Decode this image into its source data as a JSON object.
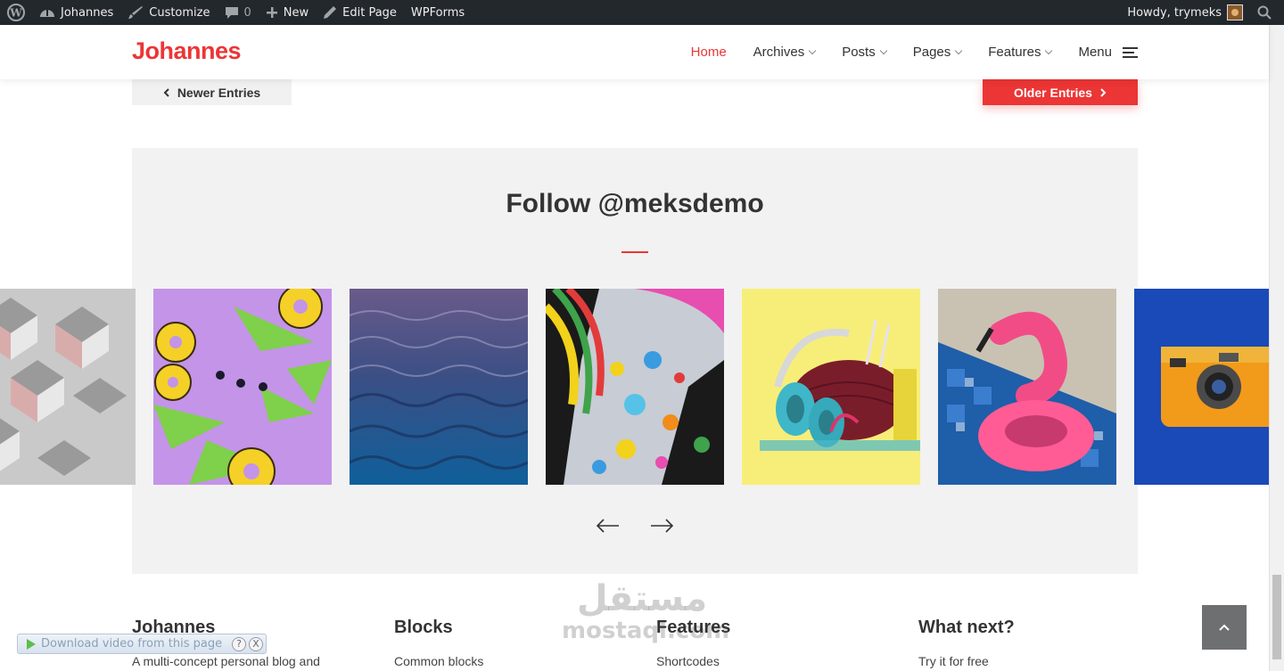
{
  "adminbar": {
    "site_name": "Johannes",
    "customize": "Customize",
    "comments_count": "0",
    "new": "New",
    "edit_page": "Edit Page",
    "wpforms": "WPForms",
    "howdy": "Howdy, trymeks"
  },
  "header": {
    "logo": "Johannes",
    "nav": [
      {
        "label": "Home"
      },
      {
        "label": "Archives"
      },
      {
        "label": "Posts"
      },
      {
        "label": "Pages"
      },
      {
        "label": "Features"
      },
      {
        "label": "Menu"
      }
    ]
  },
  "pagination": {
    "newer": "Newer Entries",
    "older": "Older Entries"
  },
  "instagram": {
    "title": "Follow @meksdemo",
    "photos": [
      "geometric-cubes",
      "pineapple-donuts",
      "ocean-waves",
      "colorful-graffiti",
      "yarn-headphones",
      "pink-flamingo-float",
      "orange-camera"
    ]
  },
  "footer": {
    "columns": [
      {
        "title": "Johannes",
        "text": "A multi-concept personal blog and"
      },
      {
        "title": "Blocks",
        "text": "Common blocks"
      },
      {
        "title": "Features",
        "text": "Shortcodes"
      },
      {
        "title": "What next?",
        "text": "Try it for free"
      }
    ]
  },
  "download_bar": {
    "label": "Download video from this page",
    "help": "?",
    "close": "X"
  },
  "watermark": {
    "arabic": "مستقل",
    "latin": "mostaql.com"
  },
  "colors": {
    "accent": "#ec3535",
    "adminbar": "#23282d",
    "section_bg": "#f2f2f2"
  }
}
